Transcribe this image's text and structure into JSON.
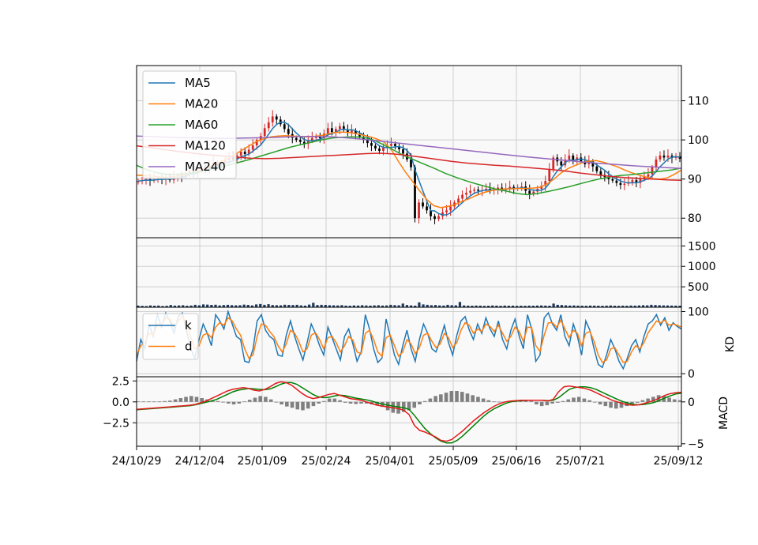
{
  "chart_data": {
    "type": "line",
    "x_tick_labels": [
      "24/10/29",
      "24/12/04",
      "25/01/09",
      "25/02/24",
      "25/04/01",
      "25/05/09",
      "25/06/16",
      "25/07/21",
      "25/09/12"
    ],
    "price_panel": {
      "type": "candlestick",
      "ylim": [
        75,
        119
      ],
      "y_ticks": [
        "80",
        "90",
        "100",
        "110"
      ],
      "legend": [
        "MA5",
        "MA20",
        "MA60",
        "MA120",
        "MA240"
      ],
      "legend_position": "upper-left",
      "grid": true,
      "colors": {
        "up": "#d62728",
        "down": "#000000",
        "MA5": "#1f77b4",
        "MA20": "#ff7f0e",
        "MA60": "#2ca02c",
        "MA120": "#d62728",
        "MA240": "#9467bd"
      },
      "close": [
        89.5,
        89.7,
        90.0,
        89.6,
        89.9,
        90.3,
        89.8,
        90.2,
        89.7,
        90.5,
        91.0,
        90.6,
        91.4,
        92.0,
        91.5,
        92.3,
        93.0,
        92.4,
        93.5,
        94.2,
        93.6,
        94.0,
        94.8,
        95.5,
        95.0,
        96.0,
        97.0,
        96.4,
        97.5,
        98.6,
        100.0,
        101.0,
        103.0,
        104.5,
        106.0,
        105.2,
        104.0,
        102.8,
        101.5,
        100.5,
        100.0,
        99.5,
        99.0,
        99.8,
        100.5,
        101.0,
        100.4,
        101.6,
        103.0,
        102.0,
        102.8,
        103.5,
        102.6,
        101.8,
        102.4,
        101.5,
        100.8,
        100.0,
        99.2,
        98.5,
        97.8,
        97.2,
        98.0,
        98.5,
        99.0,
        98.4,
        97.6,
        96.5,
        95.0,
        93.0,
        80.0,
        84.0,
        83.0,
        82.0,
        80.5,
        79.8,
        80.5,
        81.5,
        82.0,
        83.0,
        84.0,
        85.0,
        86.0,
        86.5,
        87.0,
        87.3,
        87.0,
        87.2,
        87.5,
        87.1,
        87.4,
        87.8,
        87.2,
        87.6,
        88.0,
        87.5,
        87.8,
        88.1,
        87.0,
        86.2,
        86.8,
        87.5,
        88.3,
        89.5,
        92.5,
        95.5,
        94.5,
        93.5,
        95.0,
        96.0,
        94.8,
        95.5,
        94.5,
        93.8,
        94.5,
        93.2,
        92.0,
        91.0,
        90.5,
        90.0,
        89.6,
        89.0,
        88.5,
        88.8,
        89.2,
        89.7,
        89.0,
        90.0,
        90.6,
        91.2,
        93.0,
        95.0,
        96.0,
        95.5,
        96.0,
        95.4,
        95.8,
        95.2
      ],
      "MA20": [
        91.0,
        90.9,
        90.8,
        90.6,
        90.4,
        90.5,
        90.8,
        91.2,
        91.6,
        92.2,
        92.9,
        93.7,
        94.5,
        95.4,
        96.4,
        97.5,
        98.6,
        99.6,
        100.3,
        100.8,
        101.0,
        101.1,
        101.0,
        100.9,
        100.8,
        100.9,
        101.1,
        101.5,
        101.9,
        102.0,
        101.9,
        101.6,
        101.2,
        100.8,
        100.2,
        99.4,
        97.5,
        94.5,
        91.8,
        89.4,
        87.0,
        84.8,
        83.2,
        82.7,
        83.0,
        83.5,
        84.3,
        85.0,
        85.8,
        86.5,
        87.0,
        87.3,
        87.5,
        87.5,
        87.6,
        87.6,
        87.7,
        87.9,
        88.7,
        90.0,
        91.6,
        92.7,
        93.5,
        94.2,
        94.6,
        94.7,
        94.3,
        93.7,
        93.1,
        92.3,
        91.6,
        91.0,
        90.5,
        90.1,
        90.0,
        90.3,
        91.2,
        92.3
      ],
      "MA60": [
        93.5,
        92.4,
        91.6,
        91.2,
        91.2,
        91.4,
        91.8,
        92.3,
        92.9,
        93.6,
        94.3,
        95.0,
        95.8,
        96.6,
        97.4,
        98.2,
        98.8,
        99.4,
        100.0,
        100.5,
        100.7,
        100.8,
        100.7,
        100.0,
        98.8,
        97.4,
        96.0,
        94.9,
        93.8,
        92.7,
        91.5,
        90.5,
        89.6,
        88.8,
        88.1,
        87.4,
        86.9,
        86.3,
        86.0,
        86.3,
        86.8,
        87.4,
        88.0,
        88.7,
        89.4,
        90.0,
        90.5,
        90.9,
        91.1,
        91.4,
        91.7,
        92.0,
        92.3,
        92.8
      ],
      "MA120": [
        98.5,
        98.0,
        97.5,
        97.0,
        96.6,
        96.2,
        95.9,
        95.6,
        95.3,
        95.2,
        95.3,
        95.5,
        95.7,
        95.9,
        96.1,
        96.3,
        96.5,
        96.6,
        96.4,
        96.0,
        95.5,
        95.0,
        94.5,
        94.1,
        93.8,
        93.5,
        93.3,
        93.0,
        92.7,
        92.4,
        92.0,
        91.5,
        91.1,
        90.7,
        90.4,
        90.2,
        90.0,
        89.8,
        89.7
      ],
      "MA240": [
        101.0,
        100.8,
        100.6,
        100.5,
        100.4,
        100.5,
        100.6,
        100.8,
        100.9,
        100.8,
        100.4,
        99.8,
        99.2,
        98.6,
        98.0,
        97.4,
        96.8,
        96.2,
        95.6,
        95.1,
        94.6,
        94.1,
        93.7,
        93.3,
        93.0,
        92.7
      ]
    },
    "volume_panel": {
      "type": "bar",
      "ylim": [
        0,
        1700
      ],
      "y_ticks": [
        "500",
        "1000",
        "1500"
      ],
      "color": "#1f3a5f",
      "values": [
        40,
        35,
        30,
        45,
        38,
        42,
        30,
        36,
        55,
        40,
        45,
        50,
        38,
        42,
        60,
        48,
        70,
        65,
        58,
        62,
        45,
        55,
        60,
        52,
        48,
        50,
        65,
        58,
        45,
        70,
        80,
        60,
        75,
        55,
        50,
        48,
        62,
        58,
        55,
        60,
        45,
        40,
        65,
        110,
        55,
        60,
        58,
        50,
        48,
        45,
        52,
        40,
        38,
        45,
        42,
        50,
        44,
        40,
        46,
        50,
        42,
        45,
        60,
        52,
        48,
        90,
        55,
        45,
        40,
        120,
        70,
        60,
        50,
        55,
        45,
        42,
        60,
        50,
        48,
        130,
        45,
        40,
        38,
        42,
        40,
        35,
        38,
        44,
        40,
        36,
        42,
        38,
        40,
        35,
        38,
        36,
        40,
        38,
        42,
        44,
        40,
        38,
        90,
        60,
        55,
        48,
        42,
        45,
        40,
        38,
        36,
        42,
        40,
        38,
        36,
        40,
        44,
        38,
        36,
        40,
        38,
        42,
        40,
        45,
        50,
        48,
        60,
        55,
        50,
        46,
        45,
        42,
        40,
        38
      ]
    },
    "kd_panel": {
      "type": "line",
      "ylim": [
        -5,
        107
      ],
      "y_ticks": [
        "0",
        "100"
      ],
      "ylabel": "KD",
      "legend": [
        "k",
        "d"
      ],
      "legend_position": "upper-left",
      "colors": {
        "k": "#1f77b4",
        "d": "#ff7f0e"
      },
      "k": [
        20,
        55,
        40,
        80,
        60,
        95,
        75,
        98,
        85,
        65,
        92,
        98,
        70,
        40,
        25,
        55,
        80,
        65,
        45,
        95,
        85,
        72,
        100,
        80,
        60,
        55,
        20,
        18,
        40,
        85,
        95,
        70,
        60,
        55,
        30,
        28,
        62,
        85,
        60,
        40,
        22,
        50,
        80,
        65,
        45,
        30,
        75,
        58,
        40,
        22,
        60,
        72,
        48,
        20,
        35,
        95,
        72,
        40,
        18,
        25,
        88,
        60,
        30,
        15,
        45,
        70,
        40,
        20,
        55,
        80,
        65,
        40,
        35,
        55,
        78,
        50,
        30,
        62,
        85,
        92,
        70,
        55,
        80,
        65,
        90,
        72,
        60,
        85,
        55,
        40,
        70,
        88,
        60,
        40,
        95,
        72,
        20,
        30,
        90,
        98,
        80,
        70,
        95,
        60,
        45,
        80,
        60,
        30,
        85,
        70,
        40,
        15,
        10,
        30,
        55,
        40,
        20,
        8,
        25,
        45,
        55,
        35,
        60,
        80,
        85,
        95,
        78,
        90,
        70,
        82,
        76,
        72
      ],
      "d": [
        30,
        45,
        50,
        65,
        62,
        80,
        78,
        90,
        88,
        75,
        85,
        93,
        80,
        60,
        40,
        45,
        62,
        65,
        58,
        75,
        82,
        78,
        90,
        85,
        72,
        62,
        40,
        25,
        30,
        60,
        80,
        78,
        68,
        60,
        45,
        35,
        48,
        70,
        65,
        52,
        35,
        40,
        62,
        66,
        55,
        40,
        58,
        60,
        50,
        35,
        45,
        60,
        54,
        35,
        32,
        65,
        70,
        55,
        35,
        28,
        58,
        62,
        45,
        28,
        35,
        55,
        48,
        32,
        42,
        62,
        65,
        52,
        42,
        48,
        65,
        58,
        42,
        50,
        70,
        82,
        78,
        65,
        72,
        68,
        80,
        76,
        68,
        78,
        65,
        52,
        60,
        75,
        68,
        52,
        75,
        74,
        45,
        36,
        62,
        82,
        82,
        75,
        86,
        72,
        58,
        70,
        65,
        45,
        65,
        68,
        52,
        30,
        18,
        22,
        40,
        42,
        30,
        18,
        20,
        35,
        45,
        40,
        50,
        66,
        75,
        85,
        82,
        86,
        78,
        80,
        78,
        75
      ]
    },
    "macd_panel": {
      "type": "bar",
      "ylim": [
        -5.3,
        3.0
      ],
      "y_ticks": [
        "2.5",
        "0.0",
        "−2.5"
      ],
      "right_ticks": [
        "0",
        "−5"
      ],
      "ylabel": "MACD",
      "colors": {
        "dif": "#e41a1c",
        "macd": "#008000",
        "hist": "#808080"
      },
      "dif": [
        -0.9,
        -0.85,
        -0.8,
        -0.75,
        -0.7,
        -0.65,
        -0.6,
        -0.55,
        -0.5,
        -0.45,
        -0.4,
        -0.3,
        -0.1,
        0.1,
        0.4,
        0.7,
        1.0,
        1.3,
        1.5,
        1.6,
        1.7,
        1.6,
        1.4,
        1.3,
        1.5,
        1.8,
        2.2,
        2.4,
        2.3,
        2.0,
        1.5,
        1.0,
        0.6,
        0.4,
        0.5,
        0.7,
        0.9,
        1.0,
        0.8,
        0.6,
        0.4,
        0.3,
        0.2,
        0.0,
        -0.2,
        -0.4,
        -0.5,
        -0.6,
        -0.7,
        -0.8,
        -1.0,
        -1.5,
        -2.8,
        -3.4,
        -3.6,
        -3.9,
        -4.2,
        -4.6,
        -4.7,
        -4.5,
        -4.0,
        -3.5,
        -2.9,
        -2.3,
        -1.8,
        -1.3,
        -0.9,
        -0.5,
        -0.2,
        0.0,
        0.1,
        0.15,
        0.2,
        0.2,
        0.2,
        0.2,
        0.2,
        0.1,
        0.3,
        1.2,
        1.8,
        1.9,
        1.8,
        1.7,
        1.6,
        1.4,
        1.1,
        0.8,
        0.5,
        0.2,
        0.0,
        -0.2,
        -0.35,
        -0.4,
        -0.35,
        -0.2,
        0.0,
        0.2,
        0.5,
        0.8,
        1.0,
        1.1,
        1.15
      ],
      "macd": [
        -0.95,
        -0.9,
        -0.85,
        -0.8,
        -0.75,
        -0.7,
        -0.65,
        -0.6,
        -0.55,
        -0.5,
        -0.45,
        -0.35,
        -0.2,
        -0.05,
        0.1,
        0.3,
        0.6,
        0.9,
        1.2,
        1.4,
        1.5,
        1.6,
        1.55,
        1.5,
        1.45,
        1.55,
        1.8,
        2.1,
        2.3,
        2.3,
        2.1,
        1.7,
        1.3,
        0.9,
        0.6,
        0.5,
        0.55,
        0.7,
        0.8,
        0.75,
        0.6,
        0.45,
        0.35,
        0.25,
        0.1,
        -0.1,
        -0.25,
        -0.4,
        -0.5,
        -0.6,
        -0.7,
        -0.9,
        -1.6,
        -2.4,
        -3.2,
        -3.8,
        -4.3,
        -4.7,
        -4.9,
        -4.9,
        -4.6,
        -4.1,
        -3.5,
        -2.9,
        -2.3,
        -1.7,
        -1.2,
        -0.8,
        -0.5,
        -0.2,
        0.0,
        0.1,
        0.15,
        0.2,
        0.2,
        0.2,
        0.2,
        0.15,
        0.2,
        0.5,
        1.0,
        1.5,
        1.7,
        1.8,
        1.8,
        1.7,
        1.5,
        1.2,
        0.9,
        0.6,
        0.3,
        0.05,
        -0.15,
        -0.3,
        -0.35,
        -0.3,
        -0.2,
        -0.05,
        0.2,
        0.5,
        0.75,
        0.95,
        1.05
      ],
      "hist": [
        0.05,
        0.05,
        0.05,
        0.05,
        0.05,
        0.1,
        0.15,
        0.3,
        0.45,
        0.6,
        0.7,
        0.6,
        0.45,
        0.3,
        0.2,
        0.1,
        -0.05,
        -0.2,
        -0.3,
        -0.2,
        0.05,
        0.25,
        0.5,
        0.7,
        0.6,
        0.3,
        0.0,
        -0.3,
        -0.55,
        -0.7,
        -0.9,
        -1.0,
        -0.8,
        -0.5,
        -0.2,
        0.1,
        0.4,
        0.4,
        0.2,
        -0.1,
        -0.2,
        -0.25,
        -0.2,
        -0.2,
        -0.3,
        -0.4,
        -0.6,
        -1.0,
        -1.3,
        -1.4,
        -1.2,
        -1.0,
        -0.7,
        -0.3,
        0.1,
        0.4,
        0.7,
        0.9,
        1.1,
        1.3,
        1.3,
        1.2,
        1.0,
        0.8,
        0.6,
        0.4,
        0.2,
        0.05,
        0.02,
        0.01,
        0.0,
        0.05,
        0.1,
        0.2,
        0.1,
        -0.3,
        -0.5,
        -0.4,
        -0.2,
        -0.1,
        0.1,
        0.3,
        0.5,
        0.6,
        0.4,
        0.2,
        0.0,
        -0.3,
        -0.5,
        -0.7,
        -0.8,
        -0.7,
        -0.5,
        -0.3,
        -0.1,
        0.2,
        0.4,
        0.6,
        0.8,
        0.7,
        0.5,
        0.3,
        0.2
      ]
    }
  }
}
